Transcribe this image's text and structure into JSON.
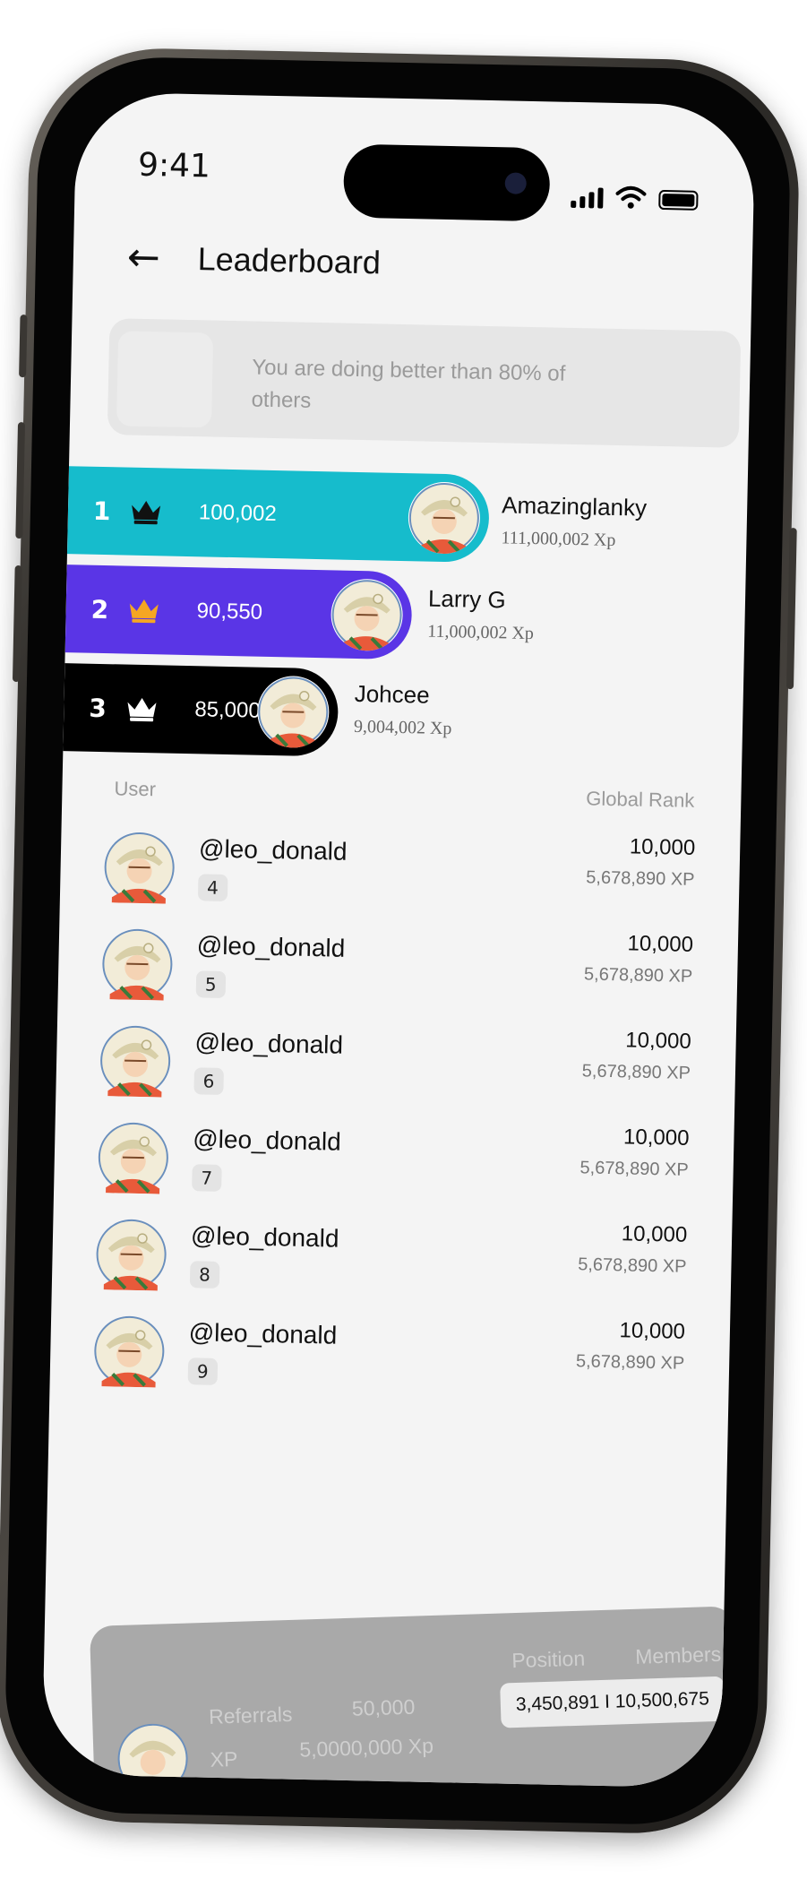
{
  "status": {
    "time": "9:41"
  },
  "header": {
    "title": "Leaderboard"
  },
  "banner": {
    "text": "You are doing better than 80% of others"
  },
  "podium": [
    {
      "rank": "1",
      "score": "100,002",
      "name": "Amazinglanky",
      "xp": "111,000,002 Xp",
      "color": "#16bccc",
      "crown_color": "#111111"
    },
    {
      "rank": "2",
      "score": "90,550",
      "name": "Larry G",
      "xp": "11,000,002 Xp",
      "color": "#5a35e6",
      "crown_color": "#f5a623"
    },
    {
      "rank": "3",
      "score": "85,000",
      "name": "Johcee",
      "xp": "9,004,002 Xp",
      "color": "#000000",
      "crown_color": "#ffffff"
    }
  ],
  "list": {
    "col_user": "User",
    "col_rank": "Global Rank",
    "rows": [
      {
        "handle": "@leo_donald",
        "rank": "4",
        "value": "10,000",
        "xp": "5,678,890 XP"
      },
      {
        "handle": "@leo_donald",
        "rank": "5",
        "value": "10,000",
        "xp": "5,678,890 XP"
      },
      {
        "handle": "@leo_donald",
        "rank": "6",
        "value": "10,000",
        "xp": "5,678,890 XP"
      },
      {
        "handle": "@leo_donald",
        "rank": "7",
        "value": "10,000",
        "xp": "5,678,890 XP"
      },
      {
        "handle": "@leo_donald",
        "rank": "8",
        "value": "10,000",
        "xp": "5,678,890 XP"
      },
      {
        "handle": "@leo_donald",
        "rank": "9",
        "value": "10,000",
        "xp": "5,678,890 XP"
      }
    ]
  },
  "footer": {
    "referrals_label": "Referrals",
    "referrals_value": "50,000",
    "xp_label": "XP",
    "xp_value": "5,0000,000 Xp",
    "position_label": "Position",
    "members_label": "Members",
    "position_members": "3,450,891 I 10,500,675"
  },
  "icons": {
    "back": "arrow-left-icon",
    "crown": "crown-icon",
    "signal": "signal-icon",
    "wifi": "wifi-icon",
    "battery": "battery-icon"
  }
}
